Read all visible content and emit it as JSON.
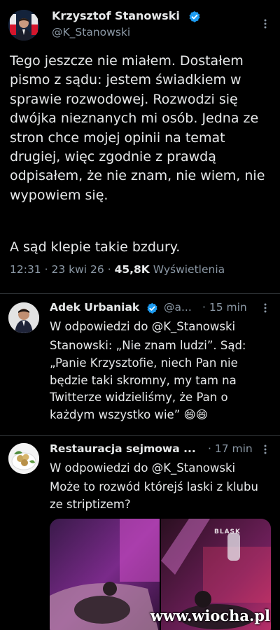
{
  "main_tweet": {
    "name": "Krzysztof Stanowski",
    "handle": "@K_Stanowski",
    "text": "Tego jeszcze nie miałem. Dostałem pismo z sądu: jestem świadkiem w sprawie rozwodowej. Rozwodzi się dwójka nieznanych mi osób. Jedna ze stron chce mojej opinii na temat drugiej, więc zgodnie z prawdą odpisałem, że nie znam, nie wiem, nie wypowiem się.",
    "text2": "A sąd klepie takie bzdury.",
    "time": "12:31",
    "date": "23 kwi 26",
    "views_count": "45,8K",
    "views_label": "Wyświetlenia",
    "sep": "·"
  },
  "replies": [
    {
      "name": "Adek Urbaniak",
      "handle": "@a...",
      "time": "· 15 min",
      "replying_prefix": "W odpowiedzi do",
      "replying_to": "@K_Stanowski",
      "text": "Stanowski: „Nie znam ludzi”. Sąd: „Panie Krzysztofie, niech Pan nie będzie taki skromny, my tam na Twitterze widzieliśmy, że Pan o każdym wszystko wie” 😄😄"
    },
    {
      "name": "Restauracja sejmowa ...",
      "time": "· 17 min",
      "replying_prefix": "W odpowiedzi do",
      "replying_to": "@K_Stanowski",
      "text": "Może to rozwód którejś laski z klubu ze striptizem?",
      "media_caption": "BLASK"
    }
  ],
  "watermark": "www.wiocha.pl",
  "colors": {
    "background": "#000000",
    "text": "#e7e9ea",
    "secondary": "#8b98a5",
    "verified": "#1d9bf0",
    "divider": "#2f3336"
  }
}
